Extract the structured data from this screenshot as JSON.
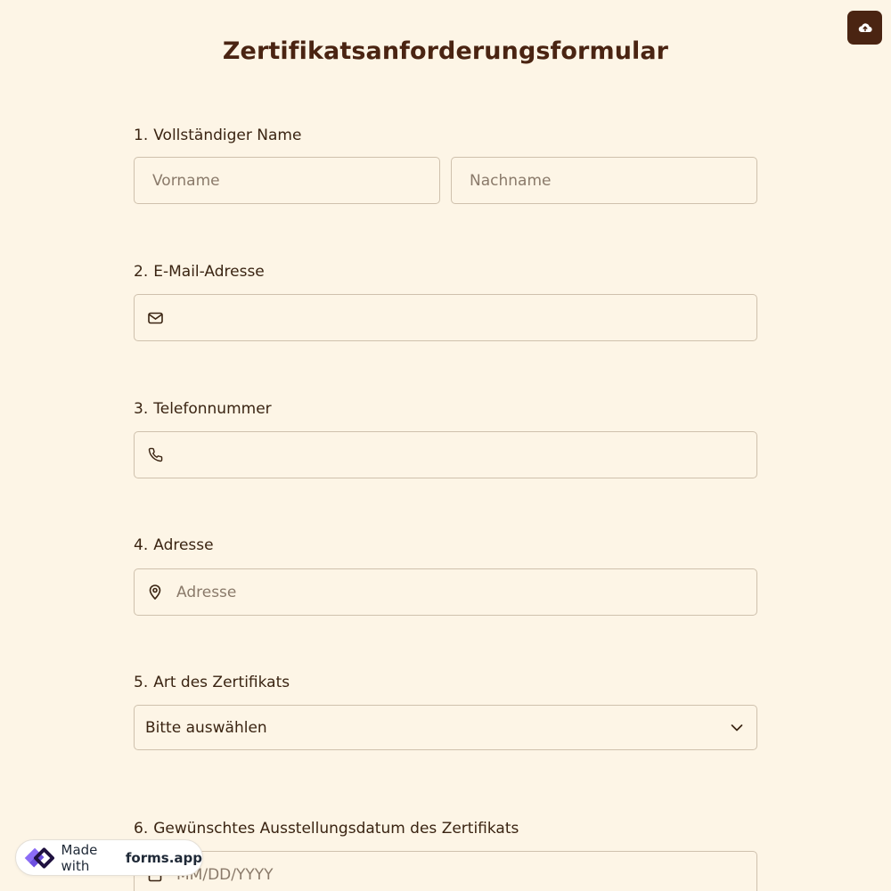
{
  "form": {
    "title": "Zertifikatsanforderungsformular"
  },
  "questions": [
    {
      "number": "1.",
      "label": "Vollständiger Name",
      "first_placeholder": "Vorname",
      "last_placeholder": "Nachname"
    },
    {
      "number": "2.",
      "label": "E-Mail-Adresse",
      "icon": "mail-icon"
    },
    {
      "number": "3.",
      "label": "Telefonnummer",
      "icon": "phone-icon"
    },
    {
      "number": "4.",
      "label": "Adresse",
      "placeholder": "Adresse",
      "icon": "map-pin-icon"
    },
    {
      "number": "5.",
      "label": "Art des Zertifikats",
      "selected_value": "Bitte auswählen",
      "icon": "chevron-down-icon"
    },
    {
      "number": "6.",
      "label": "Gewünschtes Ausstellungsdatum des Zertifikats",
      "placeholder": "MM/DD/YYYY",
      "icon": "calendar-icon"
    }
  ],
  "toolbar": {
    "upload_icon": "cloud-upload-icon"
  },
  "footer_badge": {
    "made_with": "Made with",
    "brand": "forms.app"
  },
  "colors": {
    "background": "#fdf5e6",
    "accent": "#4a2412",
    "field_border": "#cfc1ad",
    "placeholder": "#8a7a6a"
  }
}
